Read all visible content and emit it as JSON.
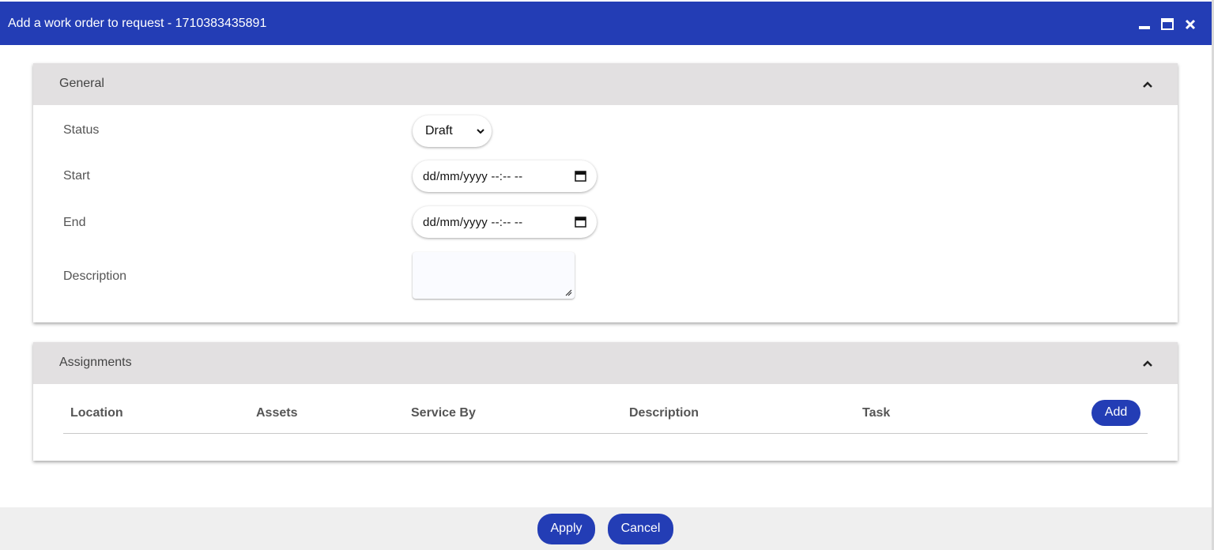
{
  "window": {
    "title": "Add a work order to request - 1710383435891"
  },
  "general": {
    "header": "General",
    "status_label": "Status",
    "status_value": "Draft",
    "start_label": "Start",
    "start_placeholder": "dd/mm/yyyy --:-- --",
    "end_label": "End",
    "end_placeholder": "dd/mm/yyyy --:-- --",
    "description_label": "Description"
  },
  "assignments": {
    "header": "Assignments",
    "columns": [
      "Location",
      "Assets",
      "Service By",
      "Description",
      "Task"
    ],
    "add_label": "Add"
  },
  "footer": {
    "apply_label": "Apply",
    "cancel_label": "Cancel"
  },
  "colors": {
    "accent": "#233db5",
    "panel_header": "#e2e0e1",
    "footer_bg": "#efefef"
  },
  "icons": [
    "minimize-icon",
    "maximize-icon",
    "close-icon",
    "chevron-up-icon",
    "chevron-down-icon",
    "calendar-icon",
    "resize-grip-icon"
  ]
}
